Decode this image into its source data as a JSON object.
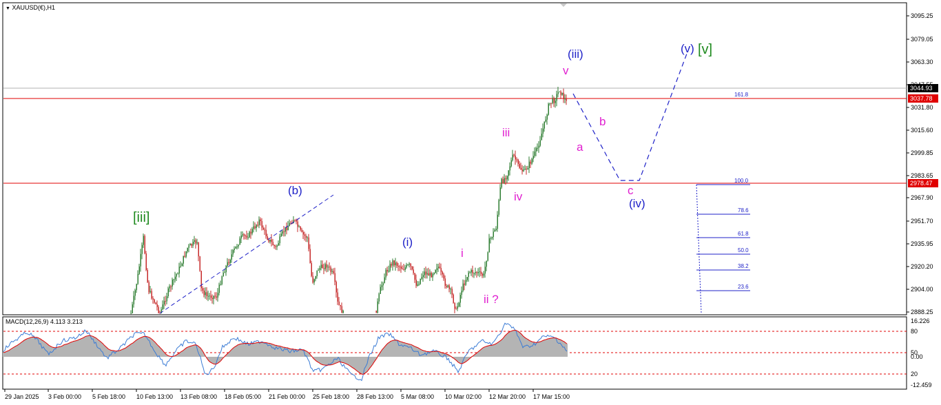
{
  "chart_title": "XAUUSD(€),H1",
  "macd_title": "MACD(12,26,9) 4.113 3.213",
  "colors": {
    "background": "#ffffff",
    "bull": "#2e7d32",
    "bear": "#c62828",
    "wave_blue": "#1f22c8",
    "wave_magenta": "#e020d0",
    "wave_green": "#1e8a1e",
    "hline_red": "#e00000",
    "fib": "#1f22c8",
    "macd_line": "#3a7bd5",
    "signal_line": "#e00000",
    "histogram": "#b4b4b4"
  },
  "price_axis": {
    "ticks": [
      "3095.25",
      "3079.05",
      "3063.30",
      "3047.55",
      "3031.80",
      "3015.60",
      "2999.85",
      "2983.65",
      "2967.90",
      "2951.70",
      "2935.95",
      "2920.20",
      "2904.00",
      "2888.25"
    ],
    "current_price": "3044.93",
    "red_line_1": "3037.78",
    "red_line_2": "2978.47"
  },
  "macd_axis": {
    "ticks": [
      "16.226",
      "80",
      "50",
      "0.00",
      "20",
      "-12.459"
    ]
  },
  "time_axis": {
    "labels": [
      "29 Jan 2025",
      "3 Feb 00:00",
      "5 Feb 18:00",
      "10 Feb 13:00",
      "13 Feb 08:00",
      "18 Feb 05:00",
      "21 Feb 00:00",
      "25 Feb 18:00",
      "28 Feb 13:00",
      "5 Mar 08:00",
      "10 Mar 02:00",
      "12 Mar 20:00",
      "17 Mar 15:00"
    ]
  },
  "fib_levels": [
    "161.8",
    "100.0",
    "78.6",
    "61.8",
    "50.0",
    "38.2",
    "23.6"
  ],
  "wave_labels": {
    "iii_major": "[iii]",
    "b_wave": "(b)",
    "i_wave": "(i)",
    "small_i": "i",
    "ii_q": "ii ?",
    "small_iii": "iii",
    "small_iv": "iv",
    "small_v": "v",
    "wave_iii": "(iii)",
    "a": "a",
    "b": "b",
    "c": "c",
    "wave_iv": "(iv)",
    "wave_v": "(v)",
    "v_major": "[v]"
  }
}
